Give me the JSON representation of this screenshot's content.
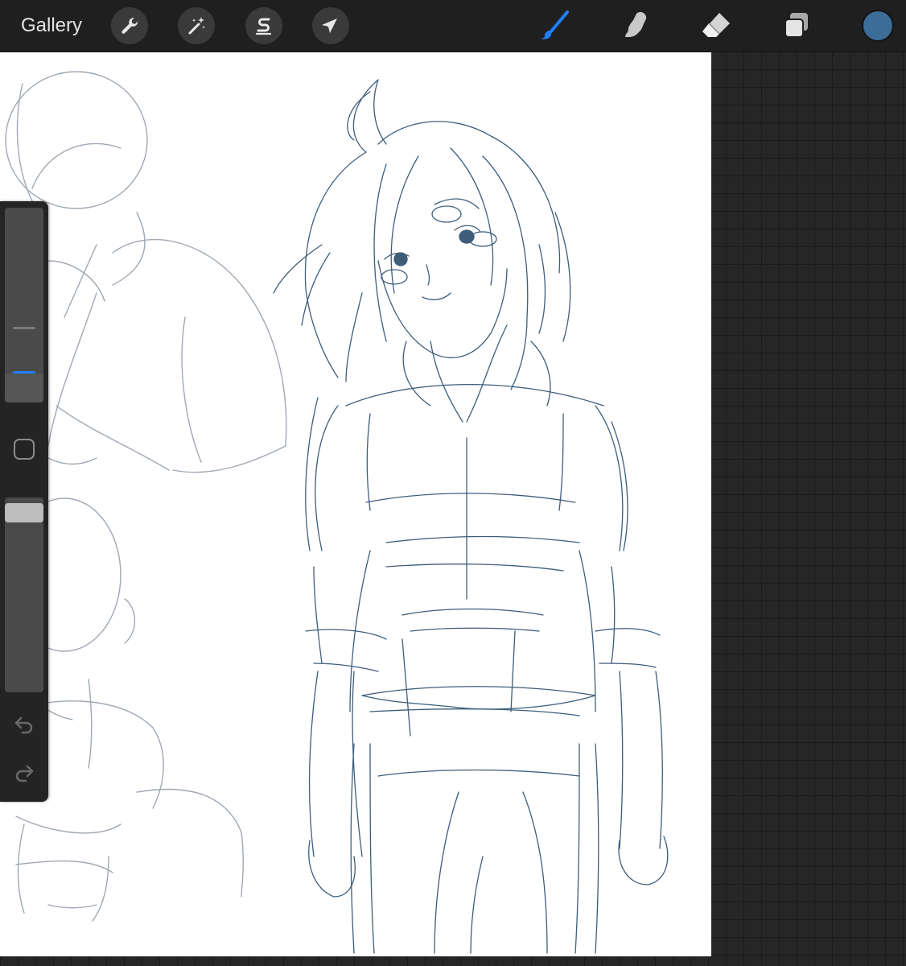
{
  "toolbar": {
    "gallery_label": "Gallery",
    "left_tools": [
      {
        "name": "actions",
        "icon": "wrench-icon"
      },
      {
        "name": "adjustments",
        "icon": "magic-wand-icon"
      },
      {
        "name": "selection",
        "icon": "selection-s-icon"
      },
      {
        "name": "transform",
        "icon": "arrow-cursor-icon"
      }
    ],
    "right_tools": [
      {
        "name": "brush",
        "icon": "brush-icon",
        "active": true
      },
      {
        "name": "smudge",
        "icon": "smudge-finger-icon",
        "active": false
      },
      {
        "name": "eraser",
        "icon": "eraser-icon",
        "active": false
      },
      {
        "name": "layers",
        "icon": "layers-icon",
        "active": false
      }
    ],
    "current_color": "#3c6c98"
  },
  "sidebar": {
    "brush_size": 0.15,
    "brush_opacity": 0.97,
    "modify_button_icon": "square-outline-icon",
    "undo_icon": "undo-arrow-icon",
    "redo_icon": "redo-arrow-icon"
  },
  "theme": {
    "accent": "#1f7fff",
    "toolbar_bg": "#1f1f1f",
    "sketch_blue": "#3d5d7b",
    "guide_gray": "#9fa8b3"
  }
}
